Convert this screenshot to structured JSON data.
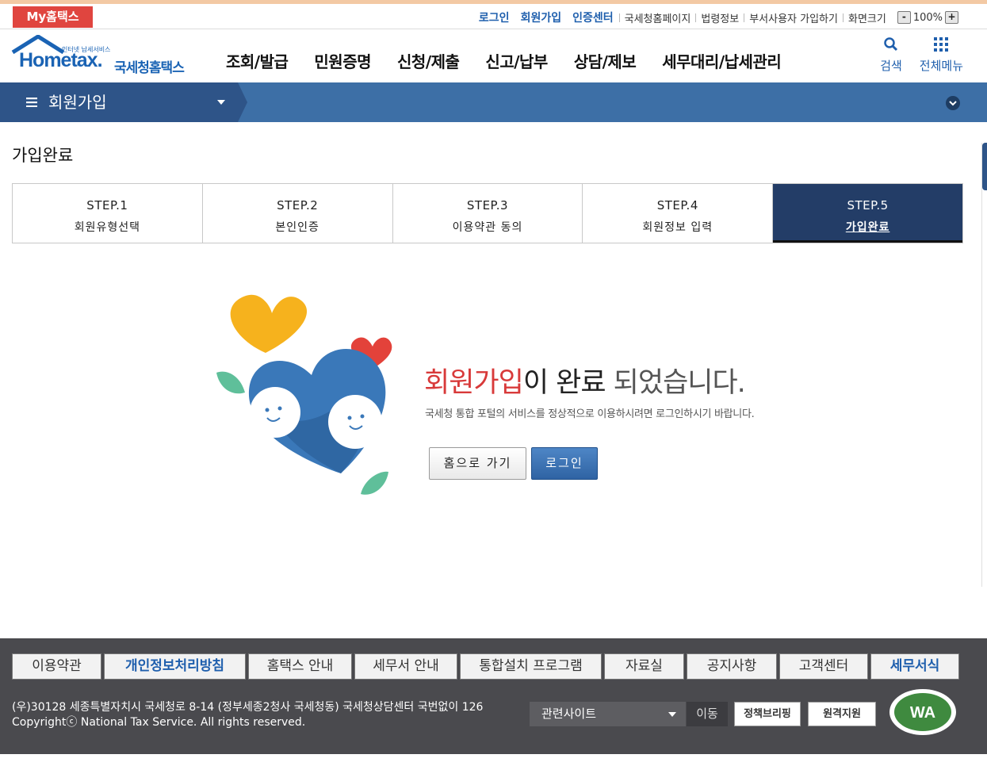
{
  "util": {
    "my_hometax": "My홈택스",
    "links_blue": [
      "로그인",
      "회원가입",
      "인증센터"
    ],
    "links": [
      "국세청홈페이지",
      "법령정보",
      "부서사용자 가입하기",
      "화면크기"
    ],
    "zoom_minus": "-",
    "zoom_value": "100%",
    "zoom_plus": "+"
  },
  "header": {
    "logo_text": "Hometax.",
    "logo_tiny": "인터넷 납세서비스",
    "logo_sub": "국세청홈택스",
    "nav": [
      "조회/발급",
      "민원증명",
      "신청/제출",
      "신고/납부",
      "상담/제보",
      "세무대리/납세관리"
    ],
    "search_label": "검색",
    "menu_label": "전체메뉴"
  },
  "bluebar": {
    "title": "회원가입"
  },
  "page": {
    "title": "가입완료",
    "steps": [
      {
        "num": "STEP.1",
        "name": "회원유형선택"
      },
      {
        "num": "STEP.2",
        "name": "본인인증"
      },
      {
        "num": "STEP.3",
        "name": "이용약관 동의"
      },
      {
        "num": "STEP.4",
        "name": "회원정보 입력"
      },
      {
        "num": "STEP.5",
        "name": "가입완료"
      }
    ],
    "active_step": 5,
    "done_red": "회원가입",
    "done_mid": "이 완료 ",
    "done_light": "되었습니다.",
    "desc": "국세청 통합 포털의 서비스를 정상적으로 이용하시려면 로그인하시기 바랍니다.",
    "btn_home": "홈으로 가기",
    "btn_login": "로그인"
  },
  "footer": {
    "links": [
      "이용약관",
      "개인정보처리방침",
      "홈택스 안내",
      "세무서 안내",
      "통합설치 프로그램",
      "자료실",
      "공지사항",
      "고객센터",
      "세무서식"
    ],
    "address": "(우)30128 세종특별자치시 국세청로 8-14 (정부세종2청사 국세청동) 국세청상담센터 국번없이 126",
    "copyright": "Copyrightⓒ National Tax Service. All rights reserved.",
    "site_select": "관련사이트",
    "go": "이동",
    "briefing": "정책브리핑",
    "remote": "원격지원",
    "wa": "WA"
  },
  "colors": {
    "brand_blue": "#1f5fad",
    "nav_dark": "#233d67",
    "accent_red": "#d83a3a",
    "footer_bg": "#4a4a4e"
  }
}
